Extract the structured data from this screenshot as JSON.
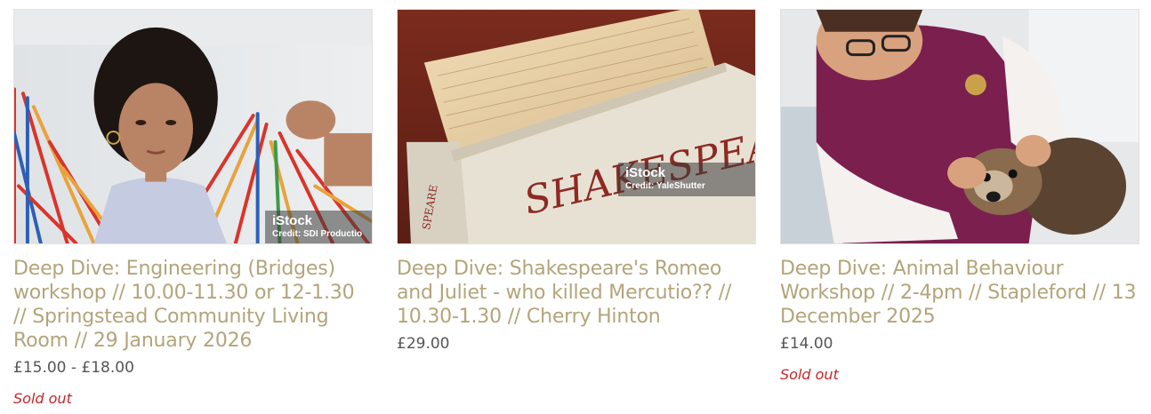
{
  "products": [
    {
      "title": "Deep Dive: Engineering (Bridges) workshop // 10.00-11.30 or 12-1.30 // Springstead Community Living Room // 29 January 2026",
      "price": "£15.00 - £18.00",
      "status": "Sold out",
      "image": {
        "subject": "girl building a bridge model",
        "watermark_brand": "iStock",
        "watermark_credit": "Credit: SDI Productio"
      }
    },
    {
      "title": "Deep Dive: Shakespeare's Romeo and Juliet - who killed Mercutio?? // 10.30-1.30 // Cherry Hinton",
      "price": "£29.00",
      "status": "",
      "image": {
        "subject": "old Shakespeare book",
        "book_title": "SHAKESPEARE",
        "spine_text": "SPEARE",
        "watermark_brand": "iStock",
        "watermark_credit": "Credit: YaleShutter"
      }
    },
    {
      "title": "Deep Dive: Animal Behaviour Workshop // 2-4pm // Stapleford // 13 December 2025",
      "price": "£14.00",
      "status": "Sold out",
      "image": {
        "subject": "vet examining a dog"
      }
    }
  ],
  "colors": {
    "title": "#b3a47a",
    "price": "#555555",
    "sold_out": "#c62828"
  }
}
